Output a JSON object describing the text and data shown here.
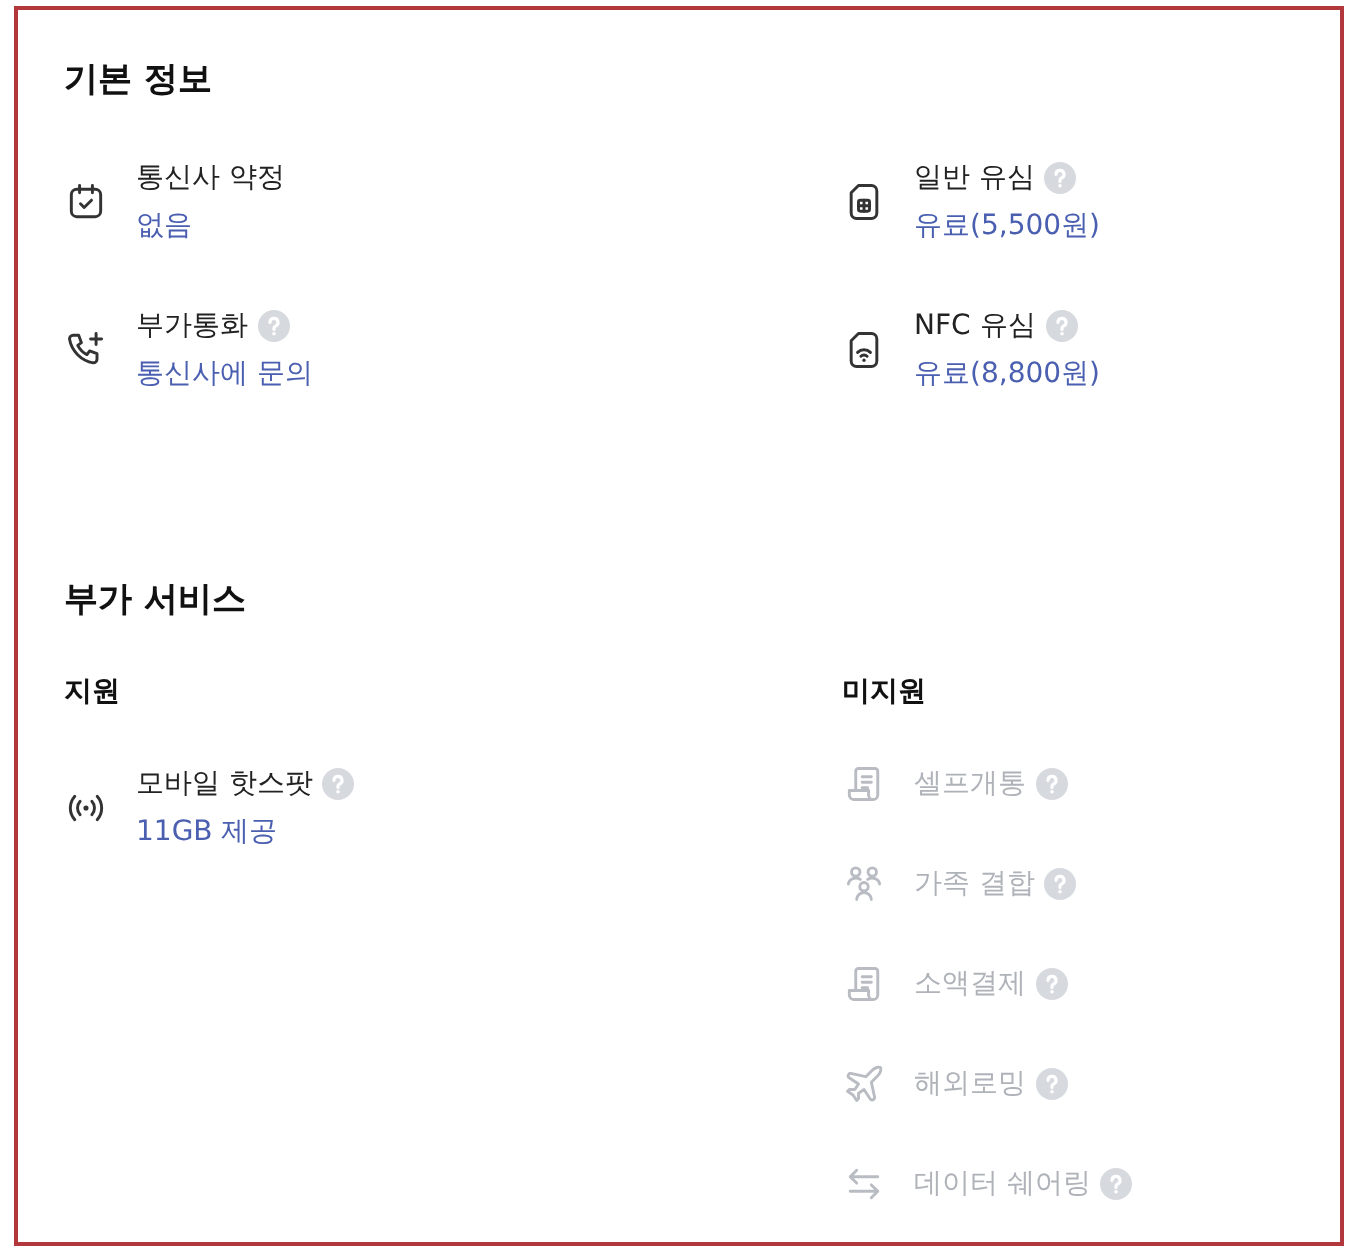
{
  "basic_info": {
    "title": "기본 정보",
    "items": [
      {
        "label": "통신사 약정",
        "value": "없음",
        "help": false
      },
      {
        "label": "일반 유심",
        "value": "유료(5,500원)",
        "help": true
      },
      {
        "label": "부가통화",
        "value": "통신사에 문의",
        "help": true
      },
      {
        "label": "NFC 유심",
        "value": "유료(8,800원)",
        "help": true
      }
    ]
  },
  "extra_services": {
    "title": "부가 서비스",
    "supported": {
      "title": "지원",
      "items": [
        {
          "label": "모바일 핫스팟",
          "value": "11GB 제공",
          "help": true,
          "disabled": false
        }
      ]
    },
    "unsupported": {
      "title": "미지원",
      "items": [
        {
          "label": "셀프개통",
          "help": true,
          "disabled": true
        },
        {
          "label": "가족 결합",
          "help": true,
          "disabled": true
        },
        {
          "label": "소액결제",
          "help": true,
          "disabled": true
        },
        {
          "label": "해외로밍",
          "help": true,
          "disabled": true
        },
        {
          "label": "데이터 쉐어링",
          "help": true,
          "disabled": true
        }
      ]
    }
  }
}
